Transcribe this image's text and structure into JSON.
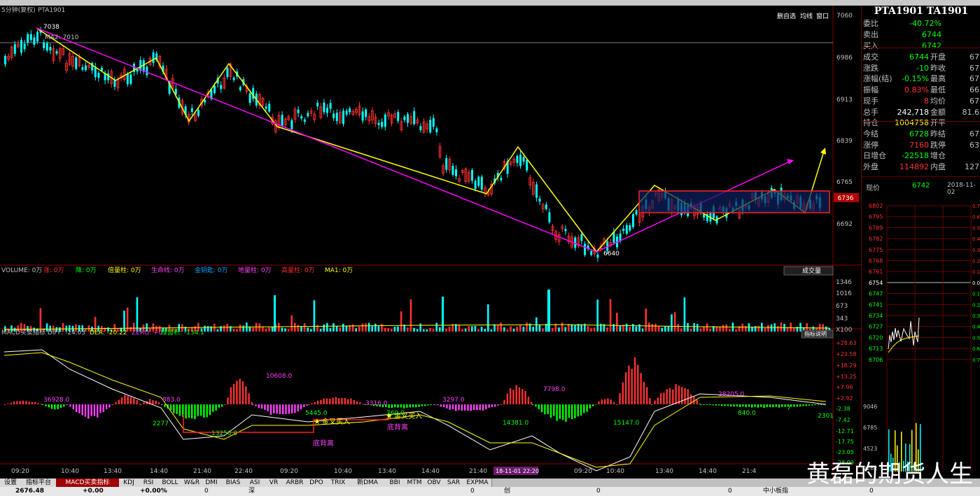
{
  "chart_header": {
    "period": "5分钟(复权)",
    "symbol": "PTA1901"
  },
  "chart_toolbar": {
    "items": [
      "删自选",
      "均线",
      "窗口"
    ]
  },
  "annotations": {
    "high_label": "7038",
    "low_label": "6640",
    "ma_label": "MA2: 7010",
    "buy1": "金叉买入",
    "buy2": "金叉买入",
    "div1": "底背离",
    "div2": "底背离",
    "price_tag": "6736",
    "date_tag": "18-11-01 22:20"
  },
  "price_axis": [
    "7060",
    "6986",
    "6913",
    "6839",
    "6765",
    "6692"
  ],
  "volume_header": {
    "title": "VOLUME: 0万",
    "items": [
      "涨: 0万",
      "降: 0万",
      "倍量柱: 0万",
      "生命线: 0万",
      "金钥匙: 0万",
      "地量柱: 0万",
      "高量柱: 0万",
      "MA1: 0万"
    ],
    "dropdown": "成交量"
  },
  "volume_axis": [
    "1346",
    "1016",
    "673",
    "343",
    "X100"
  ],
  "macd_header": {
    "title": "MACD买卖指标 DIFF: -24.03",
    "dea": "DEA: -20.22",
    "zero": "ZERO: +0",
    "area": "绿面积: -134.1",
    "button": "指标说明"
  },
  "macd_axis": [
    "+28.63",
    "+23.58",
    "+18.29",
    "+13.25",
    "+7.96",
    "+2.92",
    "-2.38",
    "-7.42",
    "-12.71",
    "-17.75",
    "-23.05",
    "-28.09"
  ],
  "macd_labels": [
    "36928.0",
    "883.0",
    "2277",
    "13256.0",
    "10608.0",
    "5445.0",
    "3316.0",
    "760.0",
    "3297.0",
    "14381.0",
    "7798.0",
    "15147.0",
    "28205.0",
    "840.0",
    "7",
    "2301"
  ],
  "time_axis": [
    "09:20",
    "10:40",
    "13:40",
    "14:40",
    "21:40",
    "22:40",
    "09:20",
    "10:40",
    "13:40",
    "14:40",
    "21:40",
    "09:20",
    "10:40",
    "13:40",
    "14:40",
    "21:4"
  ],
  "side": {
    "title": "PTA1901 TA1901",
    "rows": [
      {
        "l": "委比",
        "v": "-40.72%",
        "c": "#00ff00"
      },
      {
        "l": "卖出",
        "v": "6744",
        "c": "#00ff00"
      },
      {
        "l": "买入",
        "v": "6742",
        "c": "#00ff00"
      }
    ],
    "rows2": [
      {
        "l": "成交",
        "v": "6744",
        "c": "#00ff00",
        "l2": "开盘",
        "v2": "67"
      },
      {
        "l": "涨跌",
        "v": "-10",
        "c": "#00ff00",
        "l2": "昨收",
        "v2": "67"
      },
      {
        "l": "涨幅(结)",
        "v": "-0.15%",
        "c": "#00ff00",
        "l2": "最高",
        "v2": "67"
      },
      {
        "l": "振幅",
        "v": "0.83%",
        "c": "#ff3030",
        "l2": "最低",
        "v2": "66"
      },
      {
        "l": "现手",
        "v": "8",
        "c": "#ff3030",
        "l2": "均价",
        "v2": "67"
      },
      {
        "l": "总手",
        "v": "242,718",
        "c": "#ffffff",
        "l2": "金额",
        "v2": "81.6"
      },
      {
        "l": "持仓",
        "v": "1004758",
        "c": "#ffff00",
        "l2": "开平",
        "v2": ""
      },
      {
        "l": "今结",
        "v": "6728",
        "c": "#00ff00",
        "l2": "昨结",
        "v2": "67"
      },
      {
        "l": "涨停",
        "v": "7160",
        "c": "#ff3030",
        "l2": "跌停",
        "v2": "63"
      },
      {
        "l": "日增仓",
        "v": "-22518",
        "c": "#00ff00",
        "l2": "增仓",
        "v2": ""
      },
      {
        "l": "外盘",
        "v": "114892",
        "c": "#ff3030",
        "l2": "内盘",
        "v2": "127"
      }
    ],
    "now_label": "现价",
    "now_value": "6742",
    "now_date": "2018-11-02",
    "mini_axis": [
      "6802",
      "6795",
      "6789",
      "6782",
      "6775",
      "6768",
      "6761",
      "6754",
      "6747",
      "6741",
      "6734",
      "6727",
      "6720",
      "6713",
      "6706"
    ],
    "mini_pct": [
      "0.71",
      "0.61",
      "0.51",
      "0.41",
      "0.31",
      "0.20",
      "0.10",
      "0.00",
      "0.10",
      "0.20",
      "0.31",
      "0.41",
      "0.51",
      "0.61",
      "0.71"
    ],
    "mini_vol_axis": [
      "9046",
      "6785",
      "4523",
      "2262"
    ]
  },
  "tabs": [
    "设置",
    "指标平台",
    "MACD买卖指标",
    "KDJ",
    "RSI",
    "BOLL",
    "W&R",
    "DMI",
    "BIAS",
    "ASI",
    "VR",
    "ARBR",
    "DPO",
    "TRIX",
    "新DMA",
    "BBI",
    "MTM",
    "OBV",
    "SAR",
    "EXPMA"
  ],
  "status": {
    "index": "2676.48",
    "chg": "+0.00",
    "pct": "+0.00%",
    "v0": "0",
    "m1": "深",
    "v1": "0",
    "m2": "创",
    "v2": "0",
    "v3": "0",
    "m3": "中小板指",
    "v4": "0"
  },
  "watermark": "黄磊的期货人生"
}
